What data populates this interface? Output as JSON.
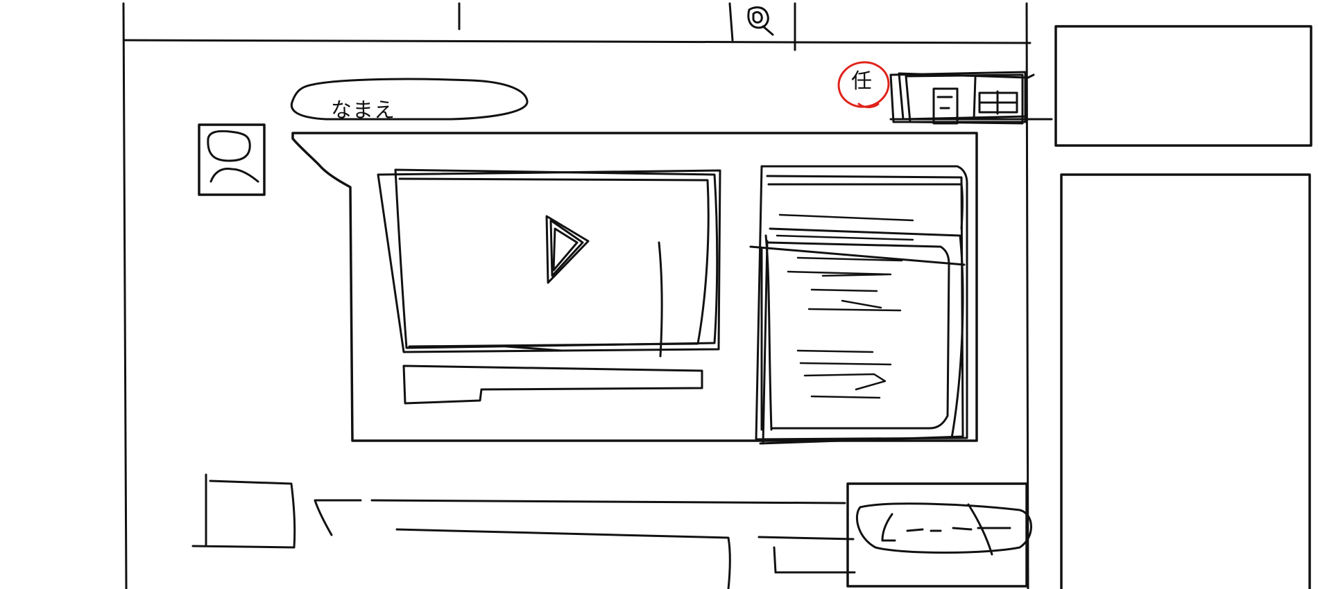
{
  "sketch": {
    "name_pill_text": "なまえ",
    "stamp_text": "任"
  },
  "colors": {
    "stroke": "#111111",
    "accent": "#e0231b",
    "background": "#ffffff"
  },
  "icons": {
    "search": "search-icon",
    "avatar": "avatar-icon",
    "play": "play-icon"
  }
}
